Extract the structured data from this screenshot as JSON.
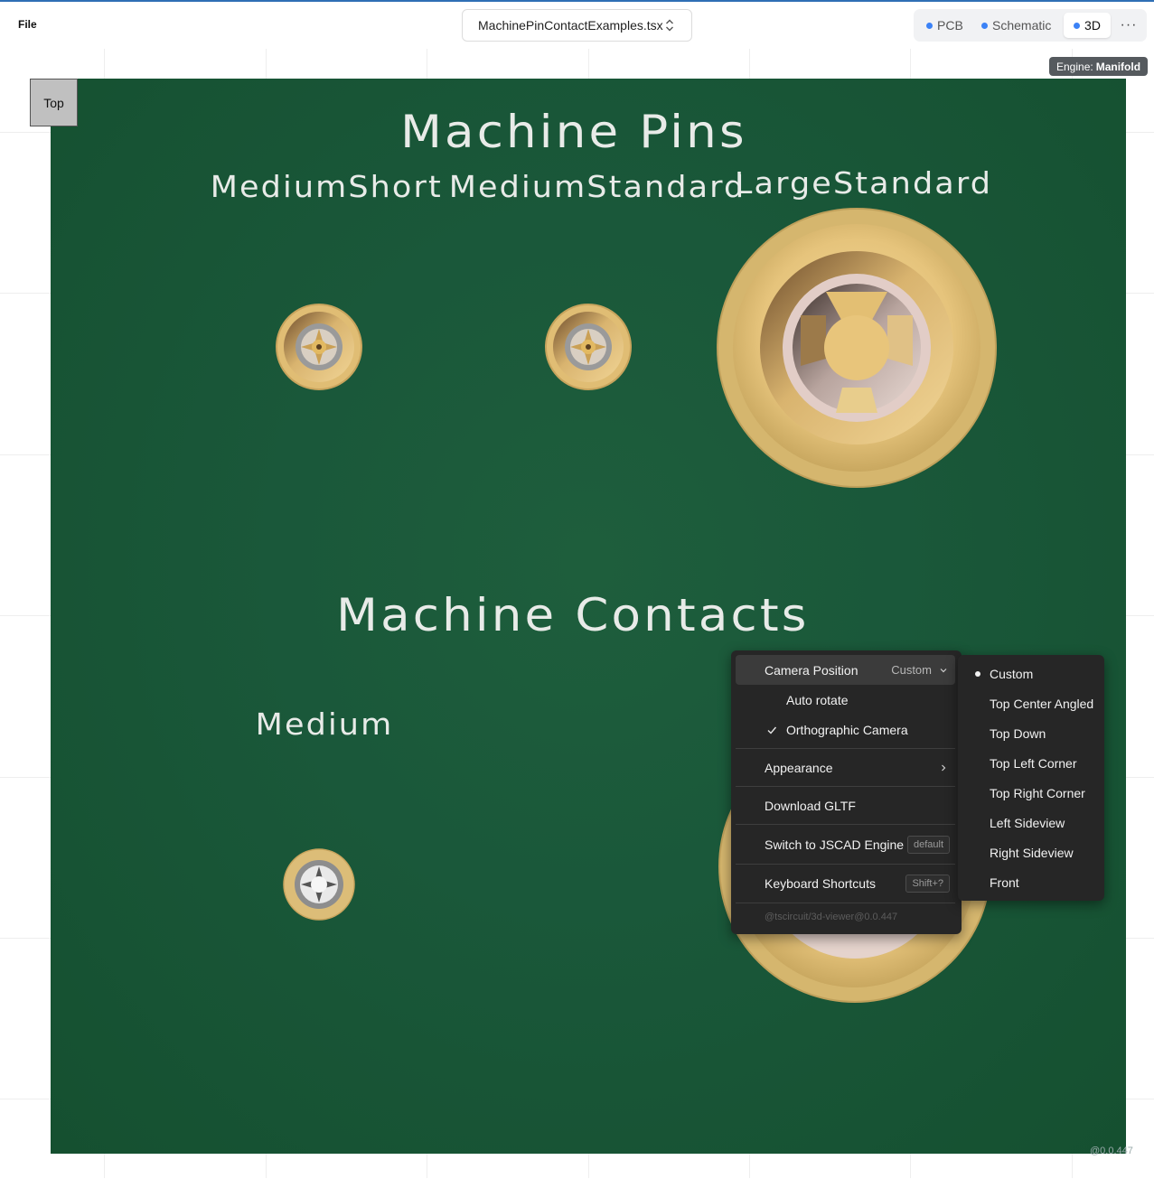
{
  "toolbar": {
    "file_menu": "File",
    "file_name": "MachinePinContactExamples.tsx",
    "tabs": [
      {
        "label": "PCB"
      },
      {
        "label": "Schematic"
      },
      {
        "label": "3D"
      }
    ],
    "more_label": "···"
  },
  "engine_badge": {
    "prefix": "Engine:",
    "name": "Manifold"
  },
  "viewer": {
    "top_button": "Top",
    "board_labels": {
      "title_pins": "Machine Pins",
      "pin1": "MediumShort",
      "pin2": "MediumStandard",
      "pin3": "LargeStandard",
      "title_contacts": "Machine Contacts",
      "contact1": "Medium"
    },
    "corner_version": "@0.0.447"
  },
  "context_menu": {
    "camera_position": {
      "label": "Camera Position",
      "value": "Custom"
    },
    "auto_rotate": "Auto rotate",
    "orthographic": {
      "label": "Orthographic Camera",
      "checked": true
    },
    "appearance": "Appearance",
    "download": "Download GLTF",
    "switch_engine": {
      "label": "Switch to JSCAD Engine",
      "badge": "default"
    },
    "shortcuts": {
      "label": "Keyboard Shortcuts",
      "badge": "Shift+?"
    },
    "version": "@tscircuit/3d-viewer@0.0.447"
  },
  "camera_submenu": {
    "selected": "Custom",
    "items": [
      "Custom",
      "Top Center Angled",
      "Top Down",
      "Top Left Corner",
      "Top Right Corner",
      "Left Sideview",
      "Right Sideview",
      "Front"
    ]
  },
  "colors": {
    "board_green": "#1a583a",
    "gold": "#e6c47c",
    "menu_bg": "#262626",
    "accent_blue": "#3b82f6"
  }
}
